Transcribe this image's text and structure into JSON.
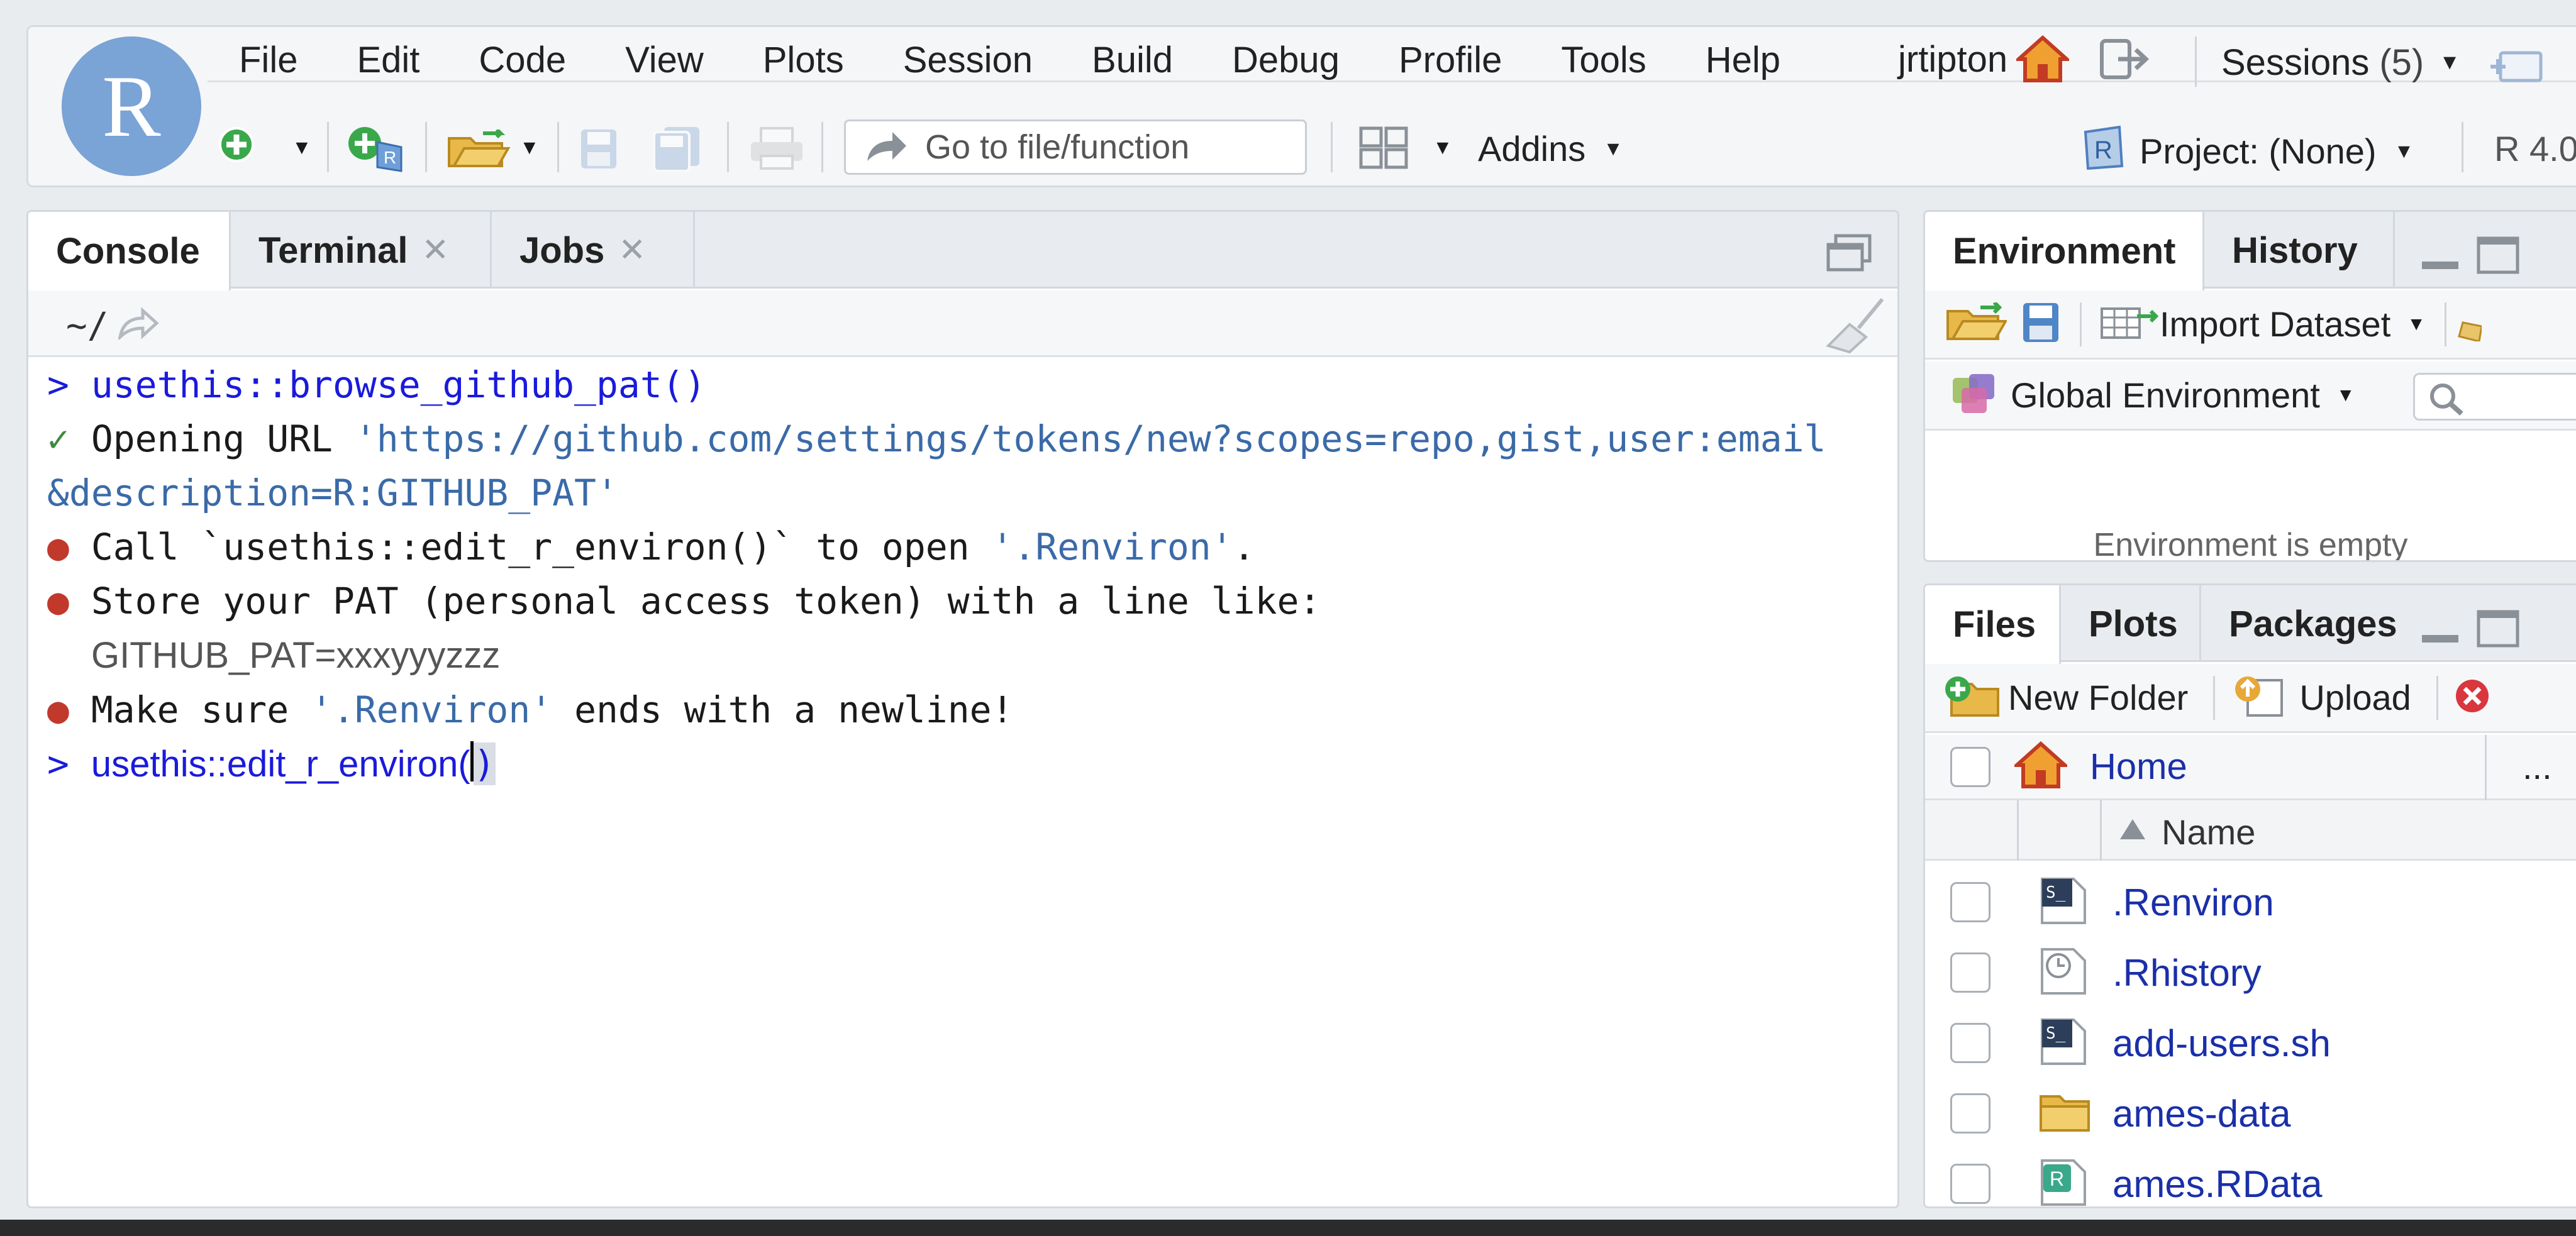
{
  "menu": {
    "items": [
      "File",
      "Edit",
      "Code",
      "View",
      "Plots",
      "Session",
      "Build",
      "Debug",
      "Profile",
      "Tools",
      "Help"
    ],
    "user": "jrtipton",
    "sessions_label": "Sessions",
    "sessions_count": "(5)"
  },
  "toolbar": {
    "goto_placeholder": "Go to file/function",
    "addins_label": "Addins",
    "project_label": "Project: (None)",
    "r_version": "R 4.0"
  },
  "console": {
    "tabs": [
      {
        "label": "Console"
      },
      {
        "label": "Terminal"
      },
      {
        "label": "Jobs"
      }
    ],
    "path": "~/",
    "lines": {
      "l1_prompt": "> ",
      "l1_cmd": "usethis::browse_github_pat()",
      "l2_check": "✓ ",
      "l2_text": "Opening URL ",
      "l2_url": "'https://github.com/settings/tokens/new?scopes=repo,gist,user:email",
      "l3_url": "&description=R:GITHUB_PAT'",
      "l4_text": "Call `usethis::edit_r_environ()` to open ",
      "l4_file": "'.Renviron'",
      "l4_end": ".",
      "l5_text": "Store your PAT (personal access token) with a line like:",
      "l6_text": "GITHUB_PAT=xxxyyyzzz",
      "l7_text_a": "Make sure ",
      "l7_file": "'.Renviron'",
      "l7_text_b": " ends with a newline!",
      "l8_prompt": "> ",
      "l8_cmd_a": "usethis::edit_r_environ(",
      "l8_cmd_b": ")"
    }
  },
  "environment": {
    "tabs": [
      {
        "label": "Environment"
      },
      {
        "label": "History"
      }
    ],
    "import_label": "Import Dataset",
    "scope_label": "Global Environment",
    "empty_text": "Environment is empty"
  },
  "files": {
    "tabs": [
      {
        "label": "Files"
      },
      {
        "label": "Plots"
      },
      {
        "label": "Packages"
      }
    ],
    "new_folder": "New Folder",
    "upload": "Upload",
    "home": "Home",
    "more": "...",
    "col_name": "Name",
    "rows": [
      {
        "name": ".Renviron",
        "icon": "shell-file-icon"
      },
      {
        "name": ".Rhistory",
        "icon": "history-file-icon"
      },
      {
        "name": "add-users.sh",
        "icon": "shell-file-icon"
      },
      {
        "name": "ames-data",
        "icon": "folder-icon"
      },
      {
        "name": "ames.RData",
        "icon": "rdata-file-icon"
      }
    ]
  },
  "colors": {
    "command_blue": "#1a1adb",
    "url_blue": "#3a6aa8",
    "bullet_red": "#c0392b",
    "check_green": "#3d8b3d",
    "link_blue": "#1a2fa8",
    "r_logo": "#7aa3d6"
  }
}
